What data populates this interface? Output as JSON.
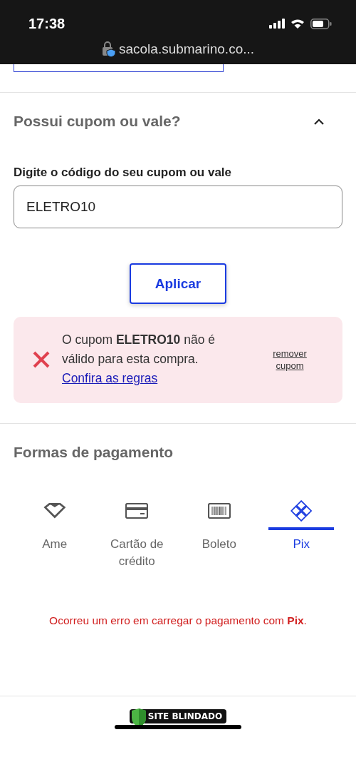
{
  "status_bar": {
    "time": "17:38",
    "url": "sacola.submarino.co..."
  },
  "coupon": {
    "title": "Possui cupom ou vale?",
    "expanded": true,
    "field_label": "Digite o código do seu cupom ou vale",
    "value": "ELETRO10",
    "apply_button": "Aplicar",
    "error": {
      "message": "O cupom **ELETRO10** não é válido para esta compra.",
      "link": "Confira as regras",
      "remove": "remover cupom"
    }
  },
  "payment": {
    "title": "Formas de pagamento",
    "tabs": [
      {
        "label": "Ame",
        "kind": "ame",
        "selected": false
      },
      {
        "label": "Cartão de crédito",
        "kind": "card",
        "selected": false
      },
      {
        "label": "Boleto",
        "kind": "boleto",
        "selected": false
      },
      {
        "label": "Pix",
        "kind": "pix",
        "selected": true
      }
    ],
    "error": "Ocorreu um erro em carregar o pagamento com **Pix**."
  },
  "footer": {
    "badge": "SITE BLINDADO"
  }
}
